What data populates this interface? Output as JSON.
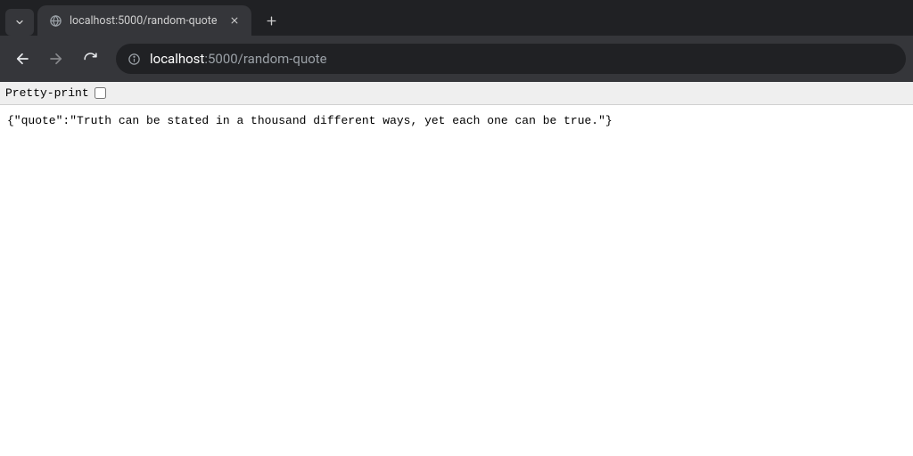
{
  "tabstrip": {
    "dropdown_aria": "Search tabs",
    "active_tab": {
      "title": "localhost:5000/random-quote",
      "favicon": "globe-icon"
    },
    "close_aria": "Close tab",
    "newtab_aria": "New tab"
  },
  "toolbar": {
    "back_aria": "Back",
    "forward_aria": "Forward",
    "reload_aria": "Reload",
    "info_aria": "View site information",
    "url_host": "localhost",
    "url_port_path": ":5000/random-quote"
  },
  "content": {
    "pretty_print_label": "Pretty-print",
    "pretty_print_checked": false,
    "body_text": "{\"quote\":\"Truth can be stated in a thousand different ways, yet each one can be true.\"}"
  }
}
